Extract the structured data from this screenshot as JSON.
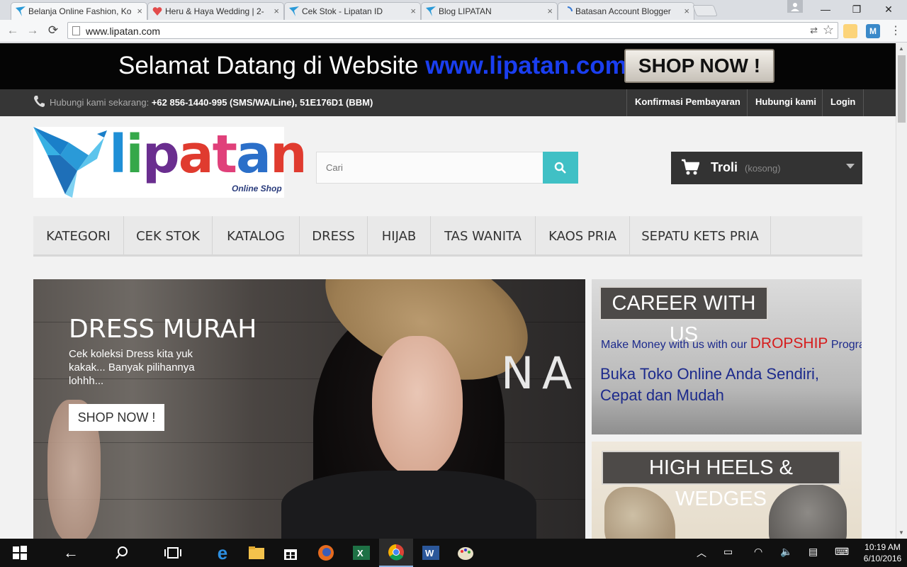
{
  "browser": {
    "tabs": [
      {
        "title": "Belanja Online Fashion, Ko",
        "active": true
      },
      {
        "title": "Heru & Haya Wedding | 2-",
        "active": false
      },
      {
        "title": "Cek Stok - Lipatan ID",
        "active": false
      },
      {
        "title": "Blog LIPATAN",
        "active": false
      },
      {
        "title": "Batasan Account Blogger",
        "active": false
      }
    ],
    "tab_close_glyph": "×",
    "url": "www.lipatan.com",
    "window_controls": {
      "minimize": "—",
      "maximize": "❐",
      "close": "✕"
    },
    "extensions": [
      {
        "icon": "extension-face-icon",
        "label": ""
      },
      {
        "icon": "extension-m-icon",
        "label": "M"
      }
    ]
  },
  "site": {
    "top_banner": {
      "welcome": "Selamat Datang di Website ",
      "welcome_url": "www.lipatan.com",
      "shop_now": "SHOP NOW !"
    },
    "contact_bar": {
      "hubungi_label": "Hubungi kami sekarang: ",
      "hubungi_value": "+62 856-1440-995 (SMS/WA/Line), 51E176D1 (BBM)",
      "links": [
        "Konfirmasi Pembayaran",
        "Hubungi kami",
        "Login"
      ]
    },
    "logo": {
      "text": "lipatan",
      "letters": [
        "l",
        "i",
        "p",
        "a",
        "t",
        "a",
        "n"
      ],
      "letter_colors": [
        "#1f8fd6",
        "#35a84a",
        "#6a2e8f",
        "#e03b2f",
        "#e0407a",
        "#2b6fc9",
        "#e03b2f"
      ],
      "subtitle": "Online Shop"
    },
    "search": {
      "placeholder": "Cari"
    },
    "cart": {
      "label": "Troli",
      "count": "(kosong)"
    },
    "menu": [
      "KATEGORI",
      "CEK STOK",
      "KATALOG",
      "DRESS",
      "HIJAB",
      "TAS WANITA",
      "KAOS PRIA",
      "SEPATU KETS PRIA"
    ],
    "hero": {
      "title": "DRESS MURAH",
      "description": "Cek koleksi Dress kita yuk kakak... Banyak pilihannya lohhh...",
      "button": "SHOP NOW !",
      "sign_letters": [
        "N",
        "A"
      ]
    },
    "career_banner": {
      "title": "CAREER WITH US",
      "line1_pre": "Make Money with us with our ",
      "line1_highlight": "DROPSHIP",
      "line1_post": " Program",
      "line2a": "Buka Toko Online Anda Sendiri,",
      "line2b": "Cepat dan Mudah"
    },
    "heels_banner": {
      "title": "HIGH HEELS & WEDGES"
    }
  },
  "taskbar": {
    "apps": [
      "start",
      "back",
      "search",
      "task-view",
      "edge",
      "file-explorer",
      "store",
      "firefox",
      "excel",
      "chrome",
      "word",
      "paint"
    ],
    "active_app": "chrome",
    "time": "10:19 AM",
    "date": "6/10/2016"
  },
  "colors": {
    "accent_search": "#40c0c5",
    "welcome_url": "#1a3ef0",
    "dropship_red": "#d61c1c",
    "career_blue": "#1c2a8c"
  }
}
